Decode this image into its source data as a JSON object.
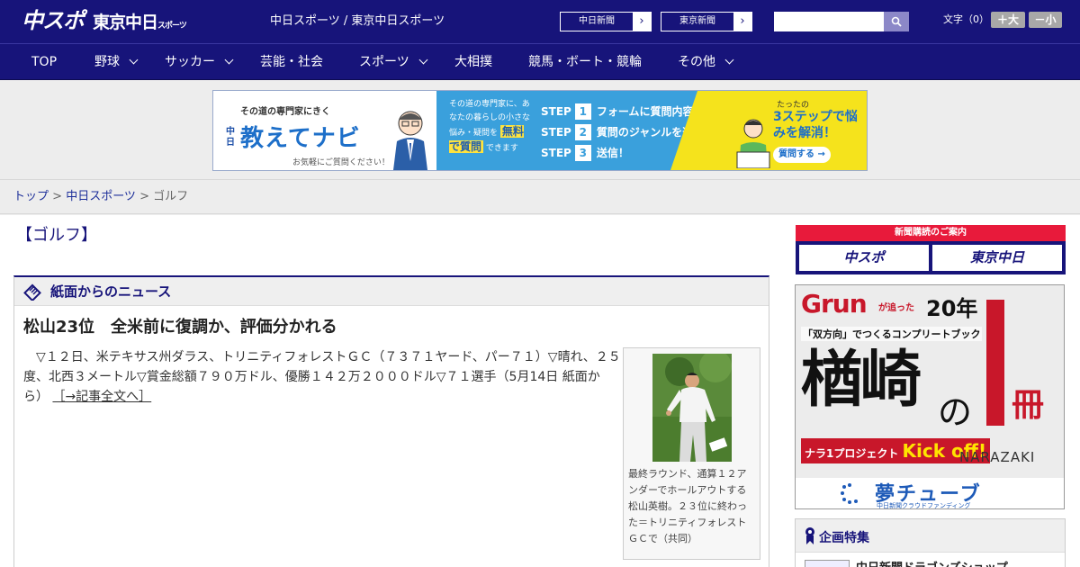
{
  "header": {
    "logo_main": "中スポ",
    "logo_sub": "東京中日",
    "logo_tiny": "スポーツ",
    "site_title": "中日スポーツ / 東京中日スポーツ",
    "links": [
      {
        "label": "中日新聞",
        "arrow": "›"
      },
      {
        "label": "東京新聞",
        "arrow": "›"
      }
    ],
    "search_placeholder": "",
    "font_size_label": "文字（0）",
    "font_bigger": "＋大",
    "font_smaller": "－小"
  },
  "nav": [
    {
      "label": "TOP",
      "dropdown": false
    },
    {
      "label": "野球",
      "dropdown": true
    },
    {
      "label": "サッカー",
      "dropdown": true
    },
    {
      "label": "芸能・社会",
      "dropdown": false
    },
    {
      "label": "スポーツ",
      "dropdown": true
    },
    {
      "label": "大相撲",
      "dropdown": false
    },
    {
      "label": "競馬・ボート・競輪",
      "dropdown": false
    },
    {
      "label": "その他",
      "dropdown": true
    }
  ],
  "banner": {
    "catch": "その道の専門家にきく",
    "brand_prefix": "中日",
    "brand": "教えてナビ",
    "note": "お気軽にご質問ください！",
    "lead": "その道の専門家に、あなたの暮らしの小さな悩み・疑問を",
    "lead_free": "無料で質問",
    "lead_end": "できます",
    "steps": [
      {
        "label": "STEP",
        "num": "1",
        "text": "フォームに質問内容を入力"
      },
      {
        "label": "STEP",
        "num": "2",
        "text": "質問のジャンルを選択"
      },
      {
        "label": "STEP",
        "num": "3",
        "text": "送信！"
      }
    ],
    "right_small": "たったの",
    "right_big": "3ステップで悩みを解消！",
    "cta": "質問する →"
  },
  "breadcrumb": {
    "home": "トップ",
    "sep1": " > ",
    "section": "中日スポーツ",
    "sep2": " > ",
    "current": "ゴルフ"
  },
  "page": {
    "section_title": "【ゴルフ】"
  },
  "news": {
    "box_label": "紙面からのニュース",
    "headline": "松山23位　全米前に復調か、評価分かれる",
    "body": "▽１２日、米テキサス州ダラス、トリニティフォレストＧＣ（７３７１ヤード、パー７１）▽晴れ、２５度、北西３メートル▽賞金総額７９０万ドル、優勝１４２万２０００ドル▽７１選手（5月14日 紙面から）",
    "more": "［→記事全文へ］",
    "photo_caption": "最終ラウンド、通算１２アンダーでホールアウトする松山英樹。２３位に終わった＝トリニティフォレストＧＣで（共同）"
  },
  "sidebar": {
    "subscribe_title": "新聞購読のご案内",
    "subscribe_a": "中スポ",
    "subscribe_b": "東京中日",
    "ad": {
      "brand": "Grun",
      "brand_sub": "が追った",
      "years": "20年",
      "bookline": "「双方向」でつくるコンプリートブック",
      "name": "楢崎",
      "no": "の",
      "satsu": "冊",
      "kick_prefix": "ナラ1プロジェクト",
      "kick": "Kick off!",
      "player": "NARAZAKI",
      "footer_logo": "夢チューブ",
      "footer_sub": "中日新聞クラウドファンディング"
    },
    "feature_title": "企画特集",
    "feature_item": "中日新聞ドラゴンズショップ"
  },
  "colors": {
    "header_bg": "#17147a",
    "accent_red": "#e81a3b",
    "link": "#1d2f9a"
  }
}
